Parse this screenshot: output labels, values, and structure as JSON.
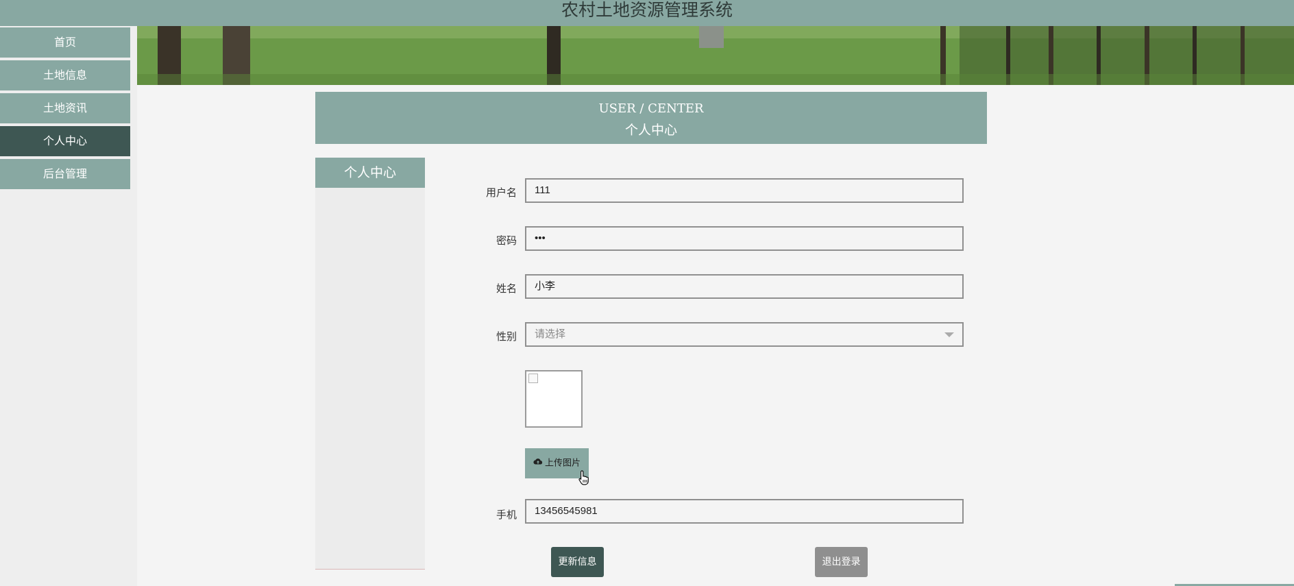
{
  "header": {
    "title": "农村土地资源管理系统"
  },
  "nav": {
    "items": [
      {
        "label": "首页"
      },
      {
        "label": "土地信息"
      },
      {
        "label": "土地资讯"
      },
      {
        "label": "个人中心"
      },
      {
        "label": "后台管理"
      }
    ],
    "active": "个人中心"
  },
  "section": {
    "title_en": "USER / CENTER",
    "title_cn": "个人中心"
  },
  "side_panel": {
    "title": "个人中心"
  },
  "form": {
    "username": {
      "label": "用户名",
      "value": "111"
    },
    "password": {
      "label": "密码",
      "value": "•••"
    },
    "name": {
      "label": "姓名",
      "value": "小李"
    },
    "gender": {
      "label": "性别",
      "placeholder": "请选择"
    },
    "upload": {
      "label": "上传图片",
      "icon": "cloud-upload-icon"
    },
    "phone": {
      "label": "手机",
      "value": "13456545981"
    }
  },
  "actions": {
    "update": "更新信息",
    "logout": "退出登录"
  },
  "colors": {
    "accent": "#88a8a2",
    "active": "#3e5753",
    "muted": "#8f8f8f"
  }
}
